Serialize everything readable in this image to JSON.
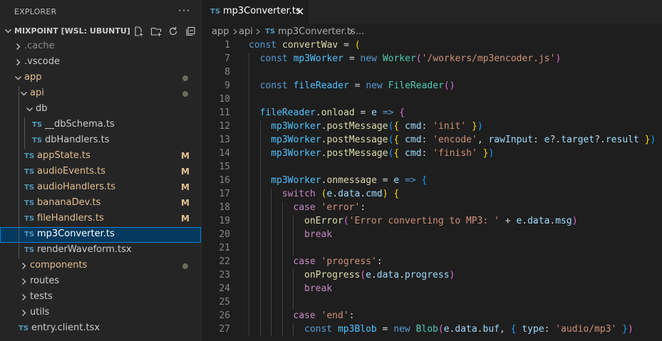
{
  "explorer": {
    "title": "EXPLORER",
    "more": "···",
    "root_name": "MIXPOINT [WSL: UBUNTU]",
    "tree": [
      {
        "label": ".cache",
        "kind": "folder",
        "depth": 0,
        "open": false,
        "color": "#8c8c8c"
      },
      {
        "label": ".vscode",
        "kind": "folder",
        "depth": 0,
        "open": false,
        "color": "#cccccc"
      },
      {
        "label": "app",
        "kind": "folder",
        "depth": 0,
        "open": true,
        "color": "#e2c08d",
        "dot": true
      },
      {
        "label": "api",
        "kind": "folder",
        "depth": 1,
        "open": true,
        "color": "#e2c08d",
        "dot": true
      },
      {
        "label": "db",
        "kind": "folder",
        "depth": 2,
        "open": true,
        "color": "#cccccc"
      },
      {
        "label": "__dbSchema.ts",
        "kind": "ts",
        "depth": 3,
        "color": "#cccccc"
      },
      {
        "label": "dbHandlers.ts",
        "kind": "ts",
        "depth": 3,
        "color": "#cccccc"
      },
      {
        "label": "appState.ts",
        "kind": "ts",
        "depth": 2,
        "color": "#e2c08d",
        "badge": "M"
      },
      {
        "label": "audioEvents.ts",
        "kind": "ts",
        "depth": 2,
        "color": "#e2c08d",
        "badge": "M"
      },
      {
        "label": "audioHandlers.ts",
        "kind": "ts",
        "depth": 2,
        "color": "#e2c08d",
        "badge": "M"
      },
      {
        "label": "bananaDev.ts",
        "kind": "ts",
        "depth": 2,
        "color": "#e2c08d",
        "badge": "M"
      },
      {
        "label": "fileHandlers.ts",
        "kind": "ts",
        "depth": 2,
        "color": "#e2c08d",
        "badge": "M"
      },
      {
        "label": "mp3Converter.ts",
        "kind": "ts",
        "depth": 2,
        "color": "#ffffff",
        "selected": true
      },
      {
        "label": "renderWaveform.tsx",
        "kind": "ts",
        "depth": 2,
        "color": "#cccccc"
      },
      {
        "label": "components",
        "kind": "folder",
        "depth": 1,
        "open": false,
        "color": "#e2c08d",
        "dot": true
      },
      {
        "label": "routes",
        "kind": "folder",
        "depth": 1,
        "open": false,
        "color": "#cccccc"
      },
      {
        "label": "tests",
        "kind": "folder",
        "depth": 1,
        "open": false,
        "color": "#cccccc"
      },
      {
        "label": "utils",
        "kind": "folder",
        "depth": 1,
        "open": false,
        "color": "#cccccc"
      },
      {
        "label": "entry.client.tsx",
        "kind": "ts",
        "depth": 1,
        "color": "#cccccc"
      }
    ]
  },
  "tab": {
    "icon": "TS",
    "name": "mp3Converter.ts"
  },
  "breadcrumb": {
    "part1": "app",
    "part2": "api",
    "icon": "TS",
    "file": "mp3Converter.ts",
    "more": "..."
  },
  "code": [
    {
      "n": "1",
      "indent": 0,
      "t": [
        [
          "kw",
          "const "
        ],
        [
          "fn",
          "convertWav"
        ],
        [
          "op",
          " = "
        ],
        [
          "bk",
          "("
        ]
      ]
    },
    {
      "n": "7",
      "indent": 1,
      "t": [
        [
          "kw",
          "const "
        ],
        [
          "cn",
          "mp3Worker"
        ],
        [
          "op",
          " = "
        ],
        [
          "kw",
          "new "
        ],
        [
          "cl",
          "Worker"
        ],
        [
          "bk2",
          "("
        ],
        [
          "st",
          "'/workers/mp3encoder.js'"
        ],
        [
          "bk2",
          ")"
        ]
      ]
    },
    {
      "n": "8",
      "indent": 1,
      "t": []
    },
    {
      "n": "9",
      "indent": 1,
      "t": [
        [
          "kw",
          "const "
        ],
        [
          "cn",
          "fileReader"
        ],
        [
          "op",
          " = "
        ],
        [
          "kw",
          "new "
        ],
        [
          "cl",
          "FileReader"
        ],
        [
          "bk2",
          "()"
        ]
      ]
    },
    {
      "n": "10",
      "indent": 1,
      "t": []
    },
    {
      "n": "11",
      "indent": 1,
      "t": [
        [
          "cn",
          "fileReader"
        ],
        [
          "op",
          "."
        ],
        [
          "fn",
          "onload"
        ],
        [
          "op",
          " = "
        ],
        [
          "vr",
          "e"
        ],
        [
          "op",
          " "
        ],
        [
          "kw",
          "=>"
        ],
        [
          "op",
          " "
        ],
        [
          "bk2",
          "{"
        ]
      ]
    },
    {
      "n": "12",
      "indent": 2,
      "t": [
        [
          "cn",
          "mp3Worker"
        ],
        [
          "op",
          "."
        ],
        [
          "fn",
          "postMessage"
        ],
        [
          "bk3",
          "("
        ],
        [
          "bk",
          "{ "
        ],
        [
          "vr",
          "cmd"
        ],
        [
          "op",
          ": "
        ],
        [
          "st",
          "'init'"
        ],
        [
          "bk",
          " }"
        ],
        [
          "bk3",
          ")"
        ]
      ]
    },
    {
      "n": "13",
      "indent": 2,
      "t": [
        [
          "cn",
          "mp3Worker"
        ],
        [
          "op",
          "."
        ],
        [
          "fn",
          "postMessage"
        ],
        [
          "bk3",
          "("
        ],
        [
          "bk",
          "{ "
        ],
        [
          "vr",
          "cmd"
        ],
        [
          "op",
          ": "
        ],
        [
          "st",
          "'encode'"
        ],
        [
          "op",
          ", "
        ],
        [
          "vr",
          "rawInput"
        ],
        [
          "op",
          ": "
        ],
        [
          "vr",
          "e"
        ],
        [
          "op",
          "?."
        ],
        [
          "vr",
          "target"
        ],
        [
          "op",
          "?."
        ],
        [
          "vr",
          "result"
        ],
        [
          "bk",
          " }"
        ],
        [
          "bk3",
          ")"
        ]
      ]
    },
    {
      "n": "14",
      "indent": 2,
      "t": [
        [
          "cn",
          "mp3Worker"
        ],
        [
          "op",
          "."
        ],
        [
          "fn",
          "postMessage"
        ],
        [
          "bk3",
          "("
        ],
        [
          "bk",
          "{ "
        ],
        [
          "vr",
          "cmd"
        ],
        [
          "op",
          ": "
        ],
        [
          "st",
          "'finish'"
        ],
        [
          "bk",
          " }"
        ],
        [
          "bk3",
          ")"
        ]
      ]
    },
    {
      "n": "15",
      "indent": 2,
      "t": []
    },
    {
      "n": "16",
      "indent": 2,
      "t": [
        [
          "cn",
          "mp3Worker"
        ],
        [
          "op",
          "."
        ],
        [
          "fn",
          "onmessage"
        ],
        [
          "op",
          " = "
        ],
        [
          "vr",
          "e"
        ],
        [
          "op",
          " "
        ],
        [
          "kw",
          "=>"
        ],
        [
          "op",
          " "
        ],
        [
          "bk3",
          "{"
        ]
      ]
    },
    {
      "n": "17",
      "indent": 3,
      "t": [
        [
          "kc",
          "switch "
        ],
        [
          "bk",
          "("
        ],
        [
          "vr",
          "e"
        ],
        [
          "op",
          "."
        ],
        [
          "vr",
          "data"
        ],
        [
          "op",
          "."
        ],
        [
          "vr",
          "cmd"
        ],
        [
          "bk",
          ")"
        ],
        [
          "op",
          " "
        ],
        [
          "bk",
          "{"
        ]
      ]
    },
    {
      "n": "18",
      "indent": 4,
      "t": [
        [
          "kc",
          "case "
        ],
        [
          "st",
          "'error'"
        ],
        [
          "op",
          ":"
        ]
      ]
    },
    {
      "n": "19",
      "indent": 5,
      "t": [
        [
          "fn",
          "onError"
        ],
        [
          "bk2",
          "("
        ],
        [
          "st",
          "'Error converting to MP3: '"
        ],
        [
          "op",
          " + "
        ],
        [
          "vr",
          "e"
        ],
        [
          "op",
          "."
        ],
        [
          "vr",
          "data"
        ],
        [
          "op",
          "."
        ],
        [
          "vr",
          "msg"
        ],
        [
          "bk2",
          ")"
        ]
      ]
    },
    {
      "n": "20",
      "indent": 5,
      "t": [
        [
          "kc",
          "break"
        ]
      ]
    },
    {
      "n": "21",
      "indent": 5,
      "t": []
    },
    {
      "n": "22",
      "indent": 4,
      "t": [
        [
          "kc",
          "case "
        ],
        [
          "st",
          "'progress'"
        ],
        [
          "op",
          ":"
        ]
      ]
    },
    {
      "n": "23",
      "indent": 5,
      "t": [
        [
          "fn",
          "onProgress"
        ],
        [
          "bk2",
          "("
        ],
        [
          "vr",
          "e"
        ],
        [
          "op",
          "."
        ],
        [
          "vr",
          "data"
        ],
        [
          "op",
          "."
        ],
        [
          "vr",
          "progress"
        ],
        [
          "bk2",
          ")"
        ]
      ]
    },
    {
      "n": "24",
      "indent": 5,
      "t": [
        [
          "kc",
          "break"
        ]
      ]
    },
    {
      "n": "25",
      "indent": 5,
      "t": []
    },
    {
      "n": "26",
      "indent": 4,
      "t": [
        [
          "kc",
          "case "
        ],
        [
          "st",
          "'end'"
        ],
        [
          "op",
          ":"
        ]
      ]
    },
    {
      "n": "27",
      "indent": 5,
      "t": [
        [
          "kw",
          "const "
        ],
        [
          "cn",
          "mp3Blob"
        ],
        [
          "op",
          " = "
        ],
        [
          "kw",
          "new "
        ],
        [
          "cl",
          "Blob"
        ],
        [
          "bk2",
          "("
        ],
        [
          "vr",
          "e"
        ],
        [
          "op",
          "."
        ],
        [
          "vr",
          "data"
        ],
        [
          "op",
          "."
        ],
        [
          "vr",
          "buf"
        ],
        [
          "op",
          ", "
        ],
        [
          "bk3",
          "{ "
        ],
        [
          "vr",
          "type"
        ],
        [
          "op",
          ": "
        ],
        [
          "st",
          "'audio/mp3'"
        ],
        [
          "bk3",
          " }"
        ],
        [
          "bk2",
          ")"
        ]
      ]
    }
  ]
}
